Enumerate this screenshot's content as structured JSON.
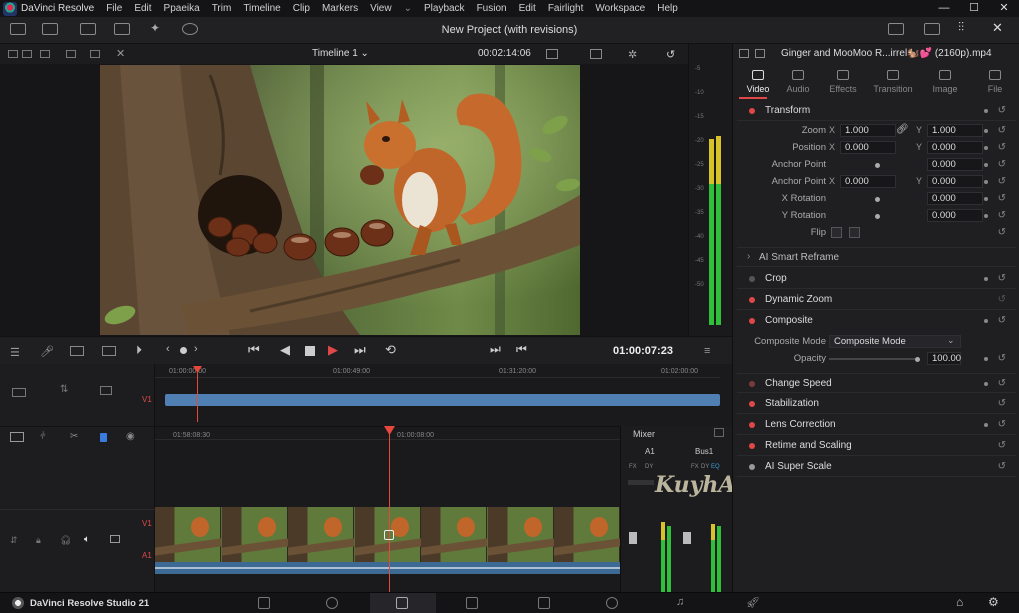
{
  "menubar": {
    "app_name": "DaVinci Resolve",
    "items": [
      "File",
      "Edit",
      "Ppaeika",
      "Trim",
      "Timeline",
      "Clip",
      "Markers",
      "View",
      "⌄",
      "Playback",
      "Fusion",
      "Edit",
      "Fairlight",
      "Workspace",
      "Help"
    ],
    "window_controls": [
      "—",
      "☐",
      "✕"
    ]
  },
  "toolbar": {
    "project_title": "New Project (with revisions)"
  },
  "viewer": {
    "timeline_name": "Timeline 1 ⌄",
    "duration_timecode": "00:02:14:06",
    "meter_labels": [
      "-5",
      "-10",
      "-15",
      "-20",
      "-25",
      "-30",
      "-35",
      "-40",
      "-45",
      "-50"
    ]
  },
  "transport": {
    "timecode": "01:00:07:23"
  },
  "timeline": {
    "upper_ruler": [
      "01:00:00:00",
      "01:00:49:00",
      "01:31:20:00",
      "01:02:00:00"
    ],
    "lower_ruler": [
      "01:58:08:30",
      "01:00:08:00"
    ],
    "track_v1": "V1",
    "track_a1": "A1",
    "upper_v1": "V1"
  },
  "mixer": {
    "title": "Mixer",
    "channels": [
      "A1",
      "Bus1"
    ],
    "fx_labels": [
      "FX",
      "DY",
      "FX",
      "DY",
      "EQ"
    ]
  },
  "watermark": {
    "text": "KuyhAaMe"
  },
  "inspector": {
    "clip_name": "Ginger and MooMoo R...irrel🐿️💕 (2160p).mp4",
    "tabs": [
      "Video",
      "Audio",
      "Effects",
      "Transition",
      "Image",
      "File"
    ],
    "active_tab": "Video",
    "transform": {
      "title": "Transform",
      "zoom_label": "Zoom",
      "zoom_x": "1.000",
      "zoom_y": "1.000",
      "position_label": "Position",
      "position_x": "0.000",
      "position_y": "0.000",
      "anchor_point_label": "Anchor Point",
      "anchor_point_val": "0.000",
      "anchor_point2_label": "Anchor Point",
      "anchor_point2_x": "0.000",
      "anchor_point2_y": "0.000",
      "x_rotation_label": "X Rotation",
      "x_rotation_val": "0.000",
      "y_rotation_label": "Y Rotation",
      "y_rotation_val": "0.000",
      "flip_label": "Flip",
      "axis_x": "X",
      "axis_y": "Y"
    },
    "smart_reframe": "AI Smart Reframe",
    "sections": {
      "crop": "Crop",
      "dynamic_zoom": "Dynamic Zoom",
      "composite": "Composite",
      "composite_mode_label": "Composite Mode",
      "composite_mode_value": "Composite Mode",
      "opacity_label": "Opacity",
      "opacity_value": "100.00",
      "change_speed": "Change Speed",
      "stabilization": "Stabilization",
      "lens_correction": "Lens Correction",
      "retime_scaling": "Retime and Scaling",
      "ai_super_scale": "AI Super Scale"
    }
  },
  "bottombar": {
    "brand": "DaVinci Resolve Studio 21"
  },
  "colors": {
    "accent_red": "#e04848",
    "playhead": "#e8473c",
    "clip_blue": "#4f7fb3",
    "meter_green": "#2fbf3a",
    "meter_yellow": "#d8c22a"
  }
}
